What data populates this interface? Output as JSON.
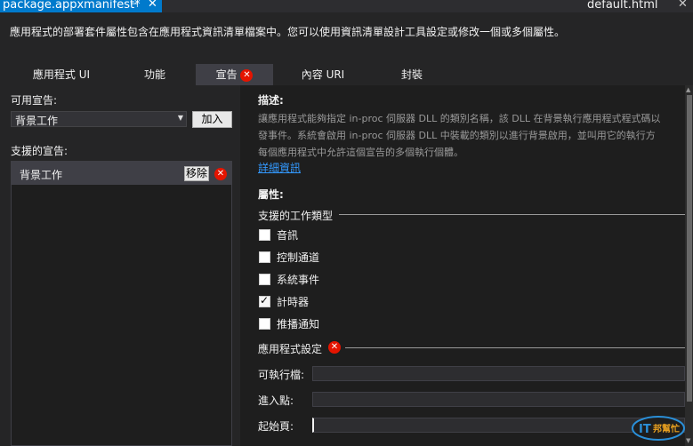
{
  "document_tab": {
    "title": "package.appxmanifest*",
    "pin_icon": "pin-icon",
    "close_icon": "close-icon"
  },
  "right_tab": {
    "title": "default.html",
    "close_icon": "close-icon"
  },
  "info": {
    "text": "應用程式的部署套件屬性包含在應用程式資訊清單檔案中。您可以使用資訊清單設計工具設定或修改一個或多個屬性。"
  },
  "tabs": [
    {
      "label": "應用程式 UI",
      "active": false
    },
    {
      "label": "功能",
      "active": false
    },
    {
      "label": "宣告",
      "active": true,
      "error": true
    },
    {
      "label": "內容 URI",
      "active": false
    },
    {
      "label": "封裝",
      "active": false
    }
  ],
  "left": {
    "available_label": "可用宣告:",
    "select_value": "背景工作",
    "add_label": "加入",
    "supported_label": "支援的宣告:",
    "supported_items": [
      {
        "label": "背景工作",
        "remove_label": "移除",
        "error": true
      }
    ]
  },
  "right": {
    "description_heading": "描述:",
    "description_lines": [
      "讓應用程式能夠指定 in-proc 伺服器 DLL 的類別名稱，該 DLL 在背景執行應用程式程式碼以",
      "發事件。系統會啟用 in-proc 伺服器 DLL 中裝載的類別以進行背景啟用，並叫用它的執行方",
      "每個應用程式中允許這個宣告的多個執行個體。"
    ],
    "more_info_link": "詳細資訊",
    "properties_heading": "屬性:",
    "task_types_heading": "支援的工作類型",
    "task_types": [
      {
        "label": "音訊",
        "checked": false
      },
      {
        "label": "控制通道",
        "checked": false
      },
      {
        "label": "系統事件",
        "checked": false
      },
      {
        "label": "計時器",
        "checked": true
      },
      {
        "label": "推播通知",
        "checked": false
      }
    ],
    "app_settings_heading": "應用程式設定",
    "fields": [
      {
        "label": "可執行檔:",
        "value": ""
      },
      {
        "label": "進入點:",
        "value": ""
      },
      {
        "label": "起始頁:",
        "value": ""
      }
    ]
  },
  "watermark": {
    "text": "IT邦幫忙"
  },
  "colors": {
    "accent": "#007acc",
    "error": "#e51400",
    "link": "#3399ff",
    "background": "#252526"
  }
}
